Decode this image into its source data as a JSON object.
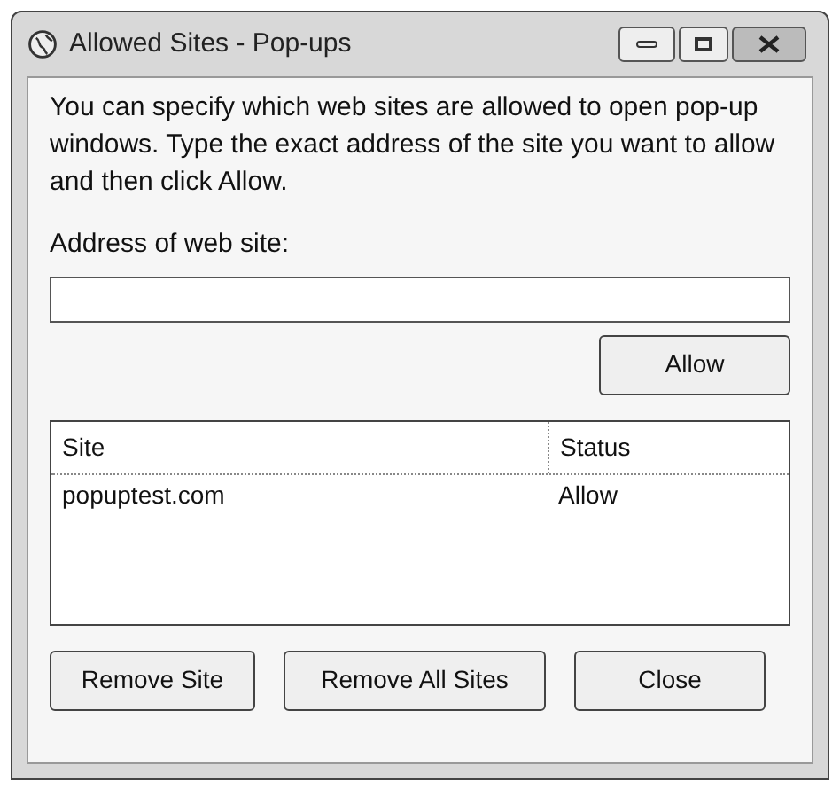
{
  "window": {
    "title": "Allowed Sites - Pop-ups"
  },
  "instructions": "You can specify which web sites are allowed to open pop-up windows. Type the exact address of the site you want to allow and then click Allow.",
  "address_label": "Address of web site:",
  "allow_button": "Allow",
  "site_list": {
    "columns": [
      "Site",
      "Status"
    ],
    "rows": [
      {
        "site": "popuptest.com",
        "status": "Allow",
        "selected": false
      }
    ]
  },
  "buttons": [
    "Remove Site",
    "Remove All Sites",
    "Close"
  ]
}
